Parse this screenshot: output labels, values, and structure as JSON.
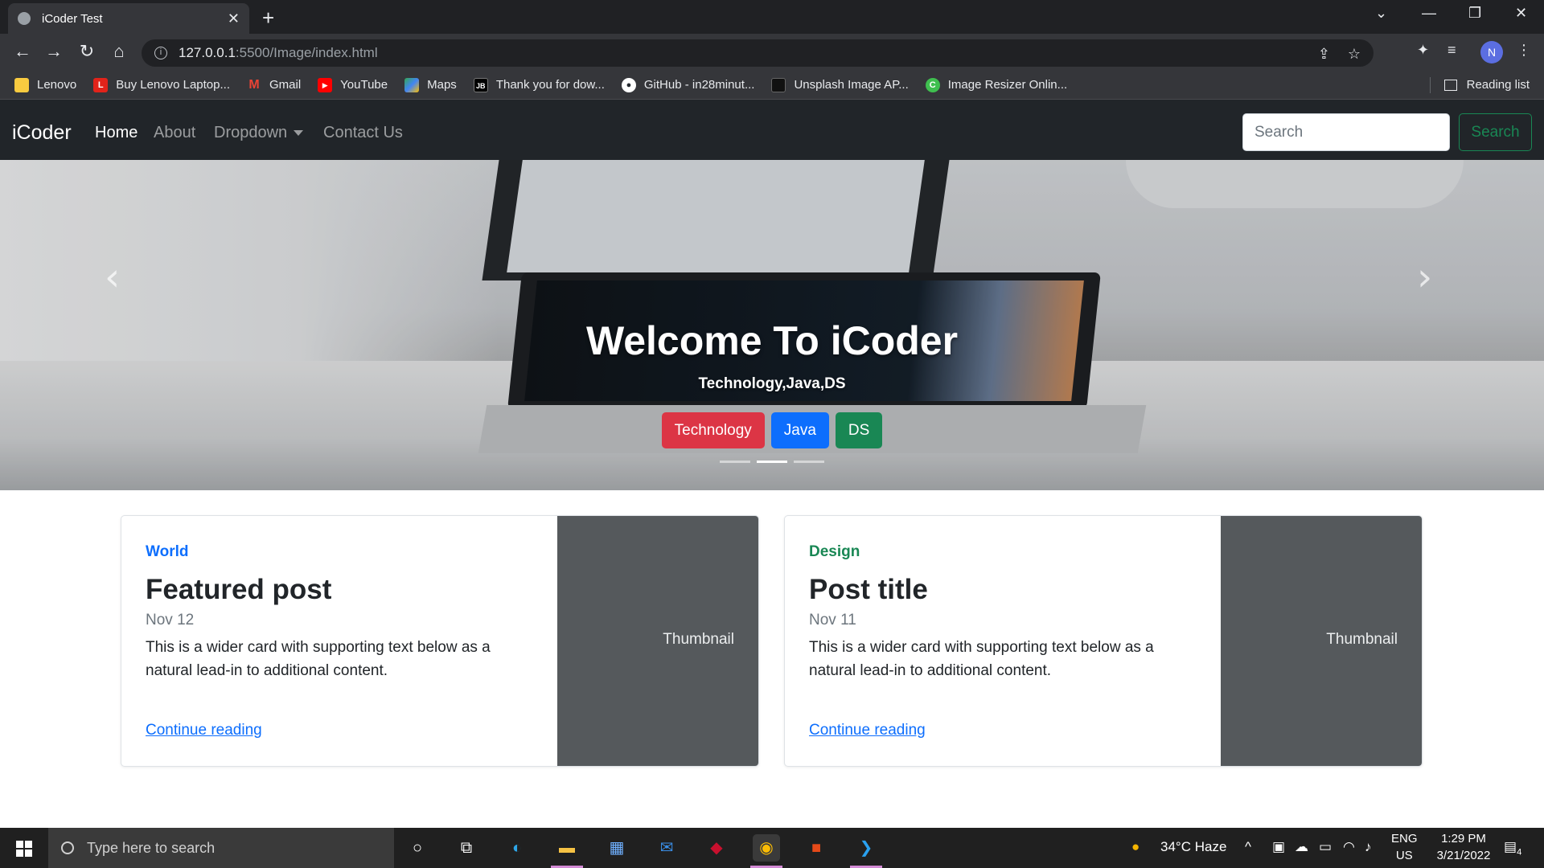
{
  "browser": {
    "tab_title": "iCoder Test",
    "url_host": "127.0.0.1",
    "url_path": ":5500/Image/index.html",
    "profile_initial": "N",
    "bookmarks": [
      {
        "label": "Lenovo",
        "icon": "folder-icon",
        "color": "#f9cb40"
      },
      {
        "label": "Buy Lenovo Laptop...",
        "icon": "lenovo-icon",
        "color": "#e2231a"
      },
      {
        "label": "Gmail",
        "icon": "gmail-icon",
        "color": "#ea4335"
      },
      {
        "label": "YouTube",
        "icon": "youtube-icon",
        "color": "#ff0000"
      },
      {
        "label": "Maps",
        "icon": "maps-icon",
        "color": "#34a853"
      },
      {
        "label": "Thank you for dow...",
        "icon": "jetbrains-icon",
        "color": "#000000"
      },
      {
        "label": "GitHub - in28minut...",
        "icon": "github-icon",
        "color": "#24292f"
      },
      {
        "label": "Unsplash Image AP...",
        "icon": "unsplash-icon",
        "color": "#111111"
      },
      {
        "label": "Image Resizer Onlin...",
        "icon": "resizer-icon",
        "color": "#3fbf4f"
      }
    ],
    "reading_list": "Reading list"
  },
  "navbar": {
    "brand": "iCoder",
    "links": [
      "Home",
      "About",
      "Dropdown",
      "Contact Us"
    ],
    "search_placeholder": "Search",
    "search_button": "Search"
  },
  "hero": {
    "title": "Welcome To iCoder",
    "subtitle": "Technology,Java,DS",
    "buttons": [
      {
        "label": "Technology",
        "color": "#dc3545"
      },
      {
        "label": "Java",
        "color": "#0d6efd"
      },
      {
        "label": "DS",
        "color": "#198754"
      }
    ],
    "active_slide": 2,
    "slide_count": 3
  },
  "cards": [
    {
      "category": "World",
      "category_color": "#0d6efd",
      "title": "Featured post",
      "date": "Nov 12",
      "text": "This is a wider card with supporting text below as a natural lead-in to additional content.",
      "link": "Continue reading",
      "thumbnail": "Thumbnail"
    },
    {
      "category": "Design",
      "category_color": "#198754",
      "title": "Post title",
      "date": "Nov 11",
      "text": "This is a wider card with supporting text below as a natural lead-in to additional content.",
      "link": "Continue reading",
      "thumbnail": "Thumbnail"
    }
  ],
  "taskbar": {
    "search_placeholder": "Type here to search",
    "weather": "34°C  Haze",
    "language_top": "ENG",
    "language_bottom": "US",
    "time": "1:29 PM",
    "date": "3/21/2022",
    "notifications": "4"
  }
}
